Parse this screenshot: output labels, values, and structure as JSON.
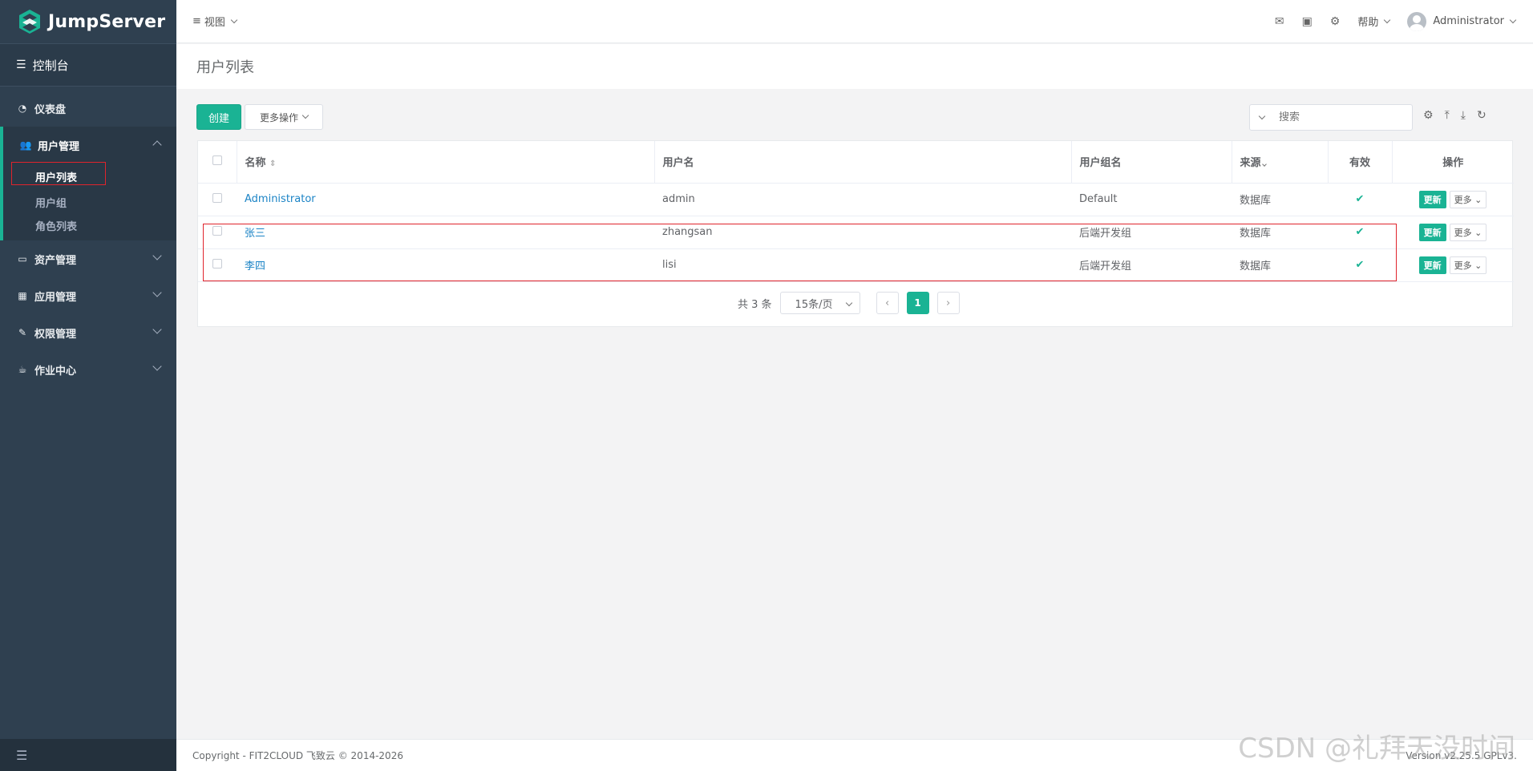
{
  "sidebar": {
    "brand": "JumpServer",
    "console": "控制台",
    "items": [
      {
        "label": "仪表盘"
      },
      {
        "label": "用户管理",
        "sub": [
          "用户列表",
          "用户组",
          "角色列表"
        ]
      },
      {
        "label": "资产管理"
      },
      {
        "label": "应用管理"
      },
      {
        "label": "权限管理"
      },
      {
        "label": "作业中心"
      }
    ]
  },
  "topbar": {
    "view": "视图",
    "help": "帮助",
    "user": "Administrator"
  },
  "page": {
    "title": "用户列表"
  },
  "toolbar": {
    "create": "创建",
    "more_actions": "更多操作",
    "search_placeholder": "搜索"
  },
  "table": {
    "headers": [
      "名称",
      "用户名",
      "用户组名",
      "来源",
      "有效",
      "操作"
    ],
    "rows": [
      {
        "name": "Administrator",
        "username": "admin",
        "group": "Default",
        "source": "数据库",
        "update": "更新",
        "more": "更多"
      },
      {
        "name": "张三",
        "username": "zhangsan",
        "group": "后端开发组",
        "source": "数据库",
        "update": "更新",
        "more": "更多"
      },
      {
        "name": "李四",
        "username": "lisi",
        "group": "后端开发组",
        "source": "数据库",
        "update": "更新",
        "more": "更多"
      }
    ]
  },
  "pagination": {
    "total": "共 3 条",
    "page_size": "15条/页",
    "current": "1"
  },
  "footer": {
    "copyright": "Copyright - FIT2CLOUD 飞致云 © 2014-2026",
    "version": "Version v2.25.5 GPLv3."
  },
  "watermark": "CSDN @礼拜天没时间",
  "colors": {
    "primary": "#1ab394",
    "sidebar": "#2f4050",
    "link": "#1c84c6",
    "highlight": "#e0242c"
  }
}
